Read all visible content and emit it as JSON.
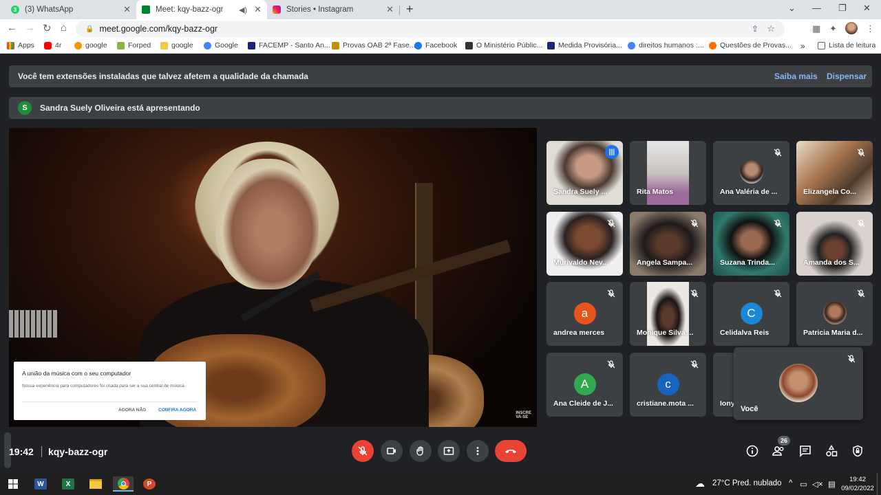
{
  "browser": {
    "tabs": [
      {
        "title": "(3) WhatsApp",
        "icon": "whatsapp-icon",
        "active": false
      },
      {
        "title": "Meet: kqy-bazz-ogr",
        "icon": "meet-icon",
        "active": true
      },
      {
        "title": "Stories • Instagram",
        "icon": "instagram-icon",
        "active": false
      }
    ],
    "url": "meet.google.com/kqy-bazz-ogr",
    "bookmarks": [
      "Apps",
      "4r",
      "google",
      "Forped",
      "google",
      "Google",
      "FACEMP - Santo An...",
      "Provas OAB 2ª Fase...",
      "Facebook",
      "O Ministério Públic...",
      "Medida Provisória...",
      "direitos humanos :...",
      "Questões de Provas..."
    ],
    "bookmarks_more": "»",
    "reading_list": "Lista de leitura"
  },
  "meet": {
    "extension_banner": {
      "text": "Você tem extensões instaladas que talvez afetem a qualidade da chamada",
      "learn_more": "Saiba mais",
      "dismiss": "Dispensar"
    },
    "presenting_banner": {
      "avatar_letter": "S",
      "text": "Sandra Suely Oliveira está apresentando"
    },
    "stage": {
      "watermark_line1": "INSCRE",
      "watermark_line2": "VA-SE",
      "popup": {
        "title": "A união da música com o seu computador",
        "body": "Nossa experiência para computadores foi criada para ser a sua central de música.",
        "decline": "AGORA NÃO",
        "accept": "CONFIRA AGORA"
      }
    },
    "participants": [
      {
        "name": "Sandra Suely ...",
        "type": "video",
        "active": true
      },
      {
        "name": "Rita Matos",
        "type": "video"
      },
      {
        "name": "Ana Valéria de ...",
        "type": "photo"
      },
      {
        "name": "Elizangela Co...",
        "type": "video"
      },
      {
        "name": "Murivaldo Nev...",
        "type": "video"
      },
      {
        "name": "Angela Sampa...",
        "type": "video"
      },
      {
        "name": "Suzana Trinda...",
        "type": "video"
      },
      {
        "name": "Amanda dos S...",
        "type": "video"
      },
      {
        "name": "andrea merces",
        "type": "letter",
        "letter": "a",
        "color": "#e8541e"
      },
      {
        "name": "Monique Silva ...",
        "type": "video"
      },
      {
        "name": "Celidalva Reis",
        "type": "letter",
        "letter": "C",
        "color": "#1a88d6"
      },
      {
        "name": "Patricia Maria d...",
        "type": "photo"
      },
      {
        "name": "Ana Cleide de J...",
        "type": "letter",
        "letter": "A",
        "color": "#33a852"
      },
      {
        "name": "cristiane.mota ...",
        "type": "letter",
        "letter": "c",
        "color": "#1565c0"
      },
      {
        "name": "Iony",
        "type": "hidden"
      }
    ],
    "self": {
      "name": "Você"
    },
    "time": "19:42",
    "meeting_code": "kqy-bazz-ogr",
    "people_count": "26"
  },
  "taskbar": {
    "weather": "27°C  Pred. nublado",
    "time": "19:42",
    "date": "09/02/2022"
  }
}
